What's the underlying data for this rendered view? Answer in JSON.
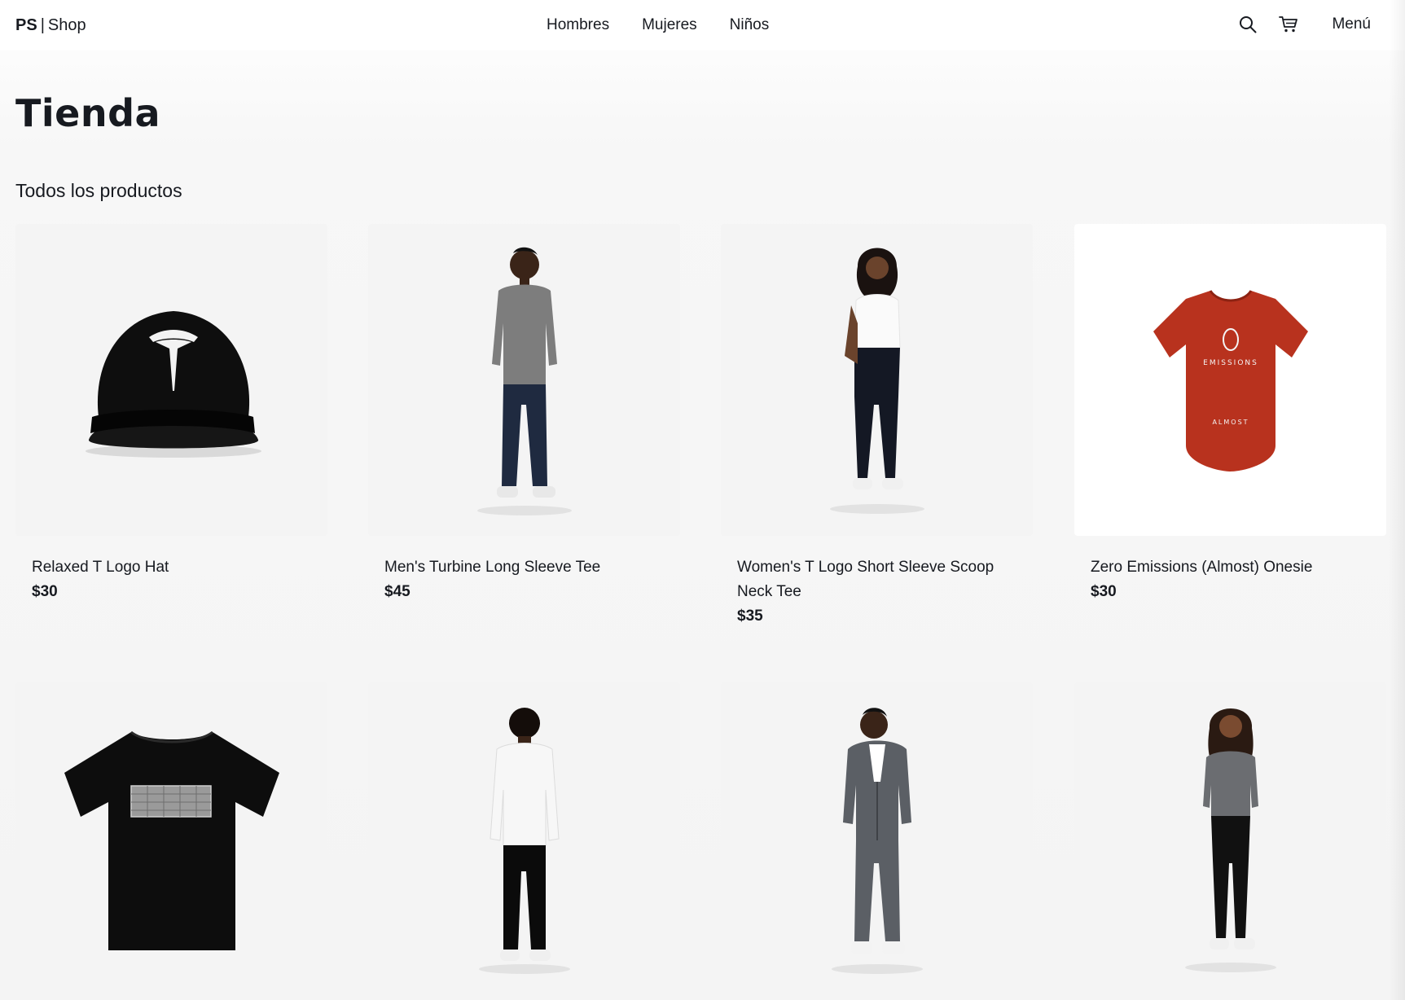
{
  "header": {
    "brand_short": "PS",
    "brand_sep": "|",
    "brand_name": "Shop",
    "nav": [
      {
        "label": "Hombres"
      },
      {
        "label": "Mujeres"
      },
      {
        "label": "Niños"
      }
    ],
    "search_icon": "search-icon",
    "cart_icon": "cart-icon",
    "menu_label": "Menú"
  },
  "page": {
    "title": "Tienda",
    "section_title": "Todos los productos"
  },
  "products": [
    {
      "name": "Relaxed T Logo Hat",
      "price": "$30",
      "image": "black cap with white logo"
    },
    {
      "name": "Men's Turbine Long Sleeve Tee",
      "price": "$45",
      "image": "man in gray long sleeve tee"
    },
    {
      "name": "Women's T Logo Short Sleeve Scoop Neck Tee",
      "price": "$35",
      "image": "woman in white scoop neck tee"
    },
    {
      "name": "Zero Emissions (Almost) Onesie",
      "price": "$30",
      "image": "red baby onesie",
      "onesie_top": "EMISSIONS",
      "onesie_bottom": "ALMOST"
    },
    {
      "image": "black t-shirt with gray print"
    },
    {
      "image": "man in white jacket, back view"
    },
    {
      "image": "man in gray tracksuit"
    },
    {
      "image": "woman in gray hoodie and black leggings"
    }
  ],
  "colors": {
    "text": "#171a20",
    "onesie_red": "#b8321e",
    "background": "#f4f4f4"
  }
}
